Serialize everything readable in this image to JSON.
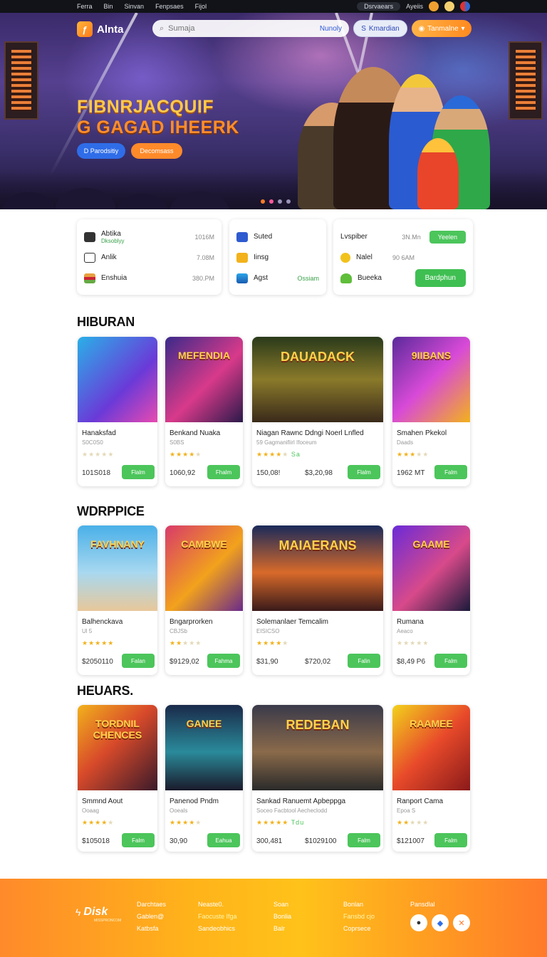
{
  "topbar": {
    "links": [
      "Ferra",
      "Bin",
      "Sinvan",
      "Fenpsaes",
      "Fijol"
    ],
    "pill1": "Dsrvaears",
    "pill2": "Ayeiis"
  },
  "header": {
    "brand": "Alnta",
    "search_placeholder": "Sumaja",
    "search_hint": "Nunoly",
    "login_label": "Kmardian",
    "promo_label": "Tanmalne"
  },
  "hero": {
    "title_line1": "FIBNRJACQUIF",
    "title_line2": "G GAGAD IHEERK",
    "btn_primary": "D  Parodsitiy",
    "btn_secondary": "Decomsass"
  },
  "info_cards": [
    {
      "rows": [
        {
          "label": "Abtika",
          "sub": "Dksoblyy",
          "value": "1016M"
        },
        {
          "label": "Anlik",
          "value": "7.08M"
        },
        {
          "label": "Enshuia",
          "value": "380.PM"
        }
      ]
    },
    {
      "rows": [
        {
          "label": "Suted"
        },
        {
          "label": "Iinsg"
        },
        {
          "label": "Agst",
          "value": "Ossiam"
        }
      ]
    },
    {
      "rows": [
        {
          "label": "Lvspiber",
          "value": "3N.Mn",
          "btn": "Yeelen"
        },
        {
          "label": "Nalel",
          "value": "90 6AM"
        },
        {
          "label": "Bueeka",
          "btn": "Bardphun"
        }
      ]
    }
  ],
  "sections": [
    {
      "title": "HIBURAN",
      "cards": [
        {
          "name": "Hanaksfad",
          "sub": "S0C0S0",
          "rating": 0,
          "price": "101S018",
          "buy": "Flalm",
          "art_text": ""
        },
        {
          "name": "Benkand Nuaka",
          "sub": "S0BS",
          "rating": 4,
          "price": "1060,92",
          "buy": "Fhalm",
          "art_text": "MEFENDIA"
        },
        {
          "name": "Niagan Rawnc Ddngi Noerl Lnfled",
          "sub": "59 Gagmanifiirl Ifoceum",
          "rating": 4,
          "rating_text": "Sa",
          "price": "150,08!",
          "price2": "$3,20,98",
          "buy": "Flalm",
          "art_text": "DAUADACK"
        },
        {
          "name": "Smahen Pkekol",
          "sub": "Daads",
          "rating": 3,
          "price": "1962 MT",
          "buy": "Falm",
          "art_text": "9IIBANS"
        }
      ]
    },
    {
      "title": "WDRPPICE",
      "cards": [
        {
          "name": "Balhenckava",
          "sub": "Ul 5",
          "rating": 5,
          "price": "$2050110",
          "buy": "Falan",
          "art_text": "FAVHNANY"
        },
        {
          "name": "Bngarprorken",
          "sub": "CBJSb",
          "rating": 2,
          "price": "$9129,02",
          "buy": "Fahma",
          "art_text": "CAMBWE"
        },
        {
          "name": "Solemanlaer Temcalim",
          "sub": "EISICSO",
          "rating": 4,
          "price": "$31,90",
          "price2": "$720,02",
          "buy": "Falin",
          "art_text": "MAIAERANS"
        },
        {
          "name": "Rumana",
          "sub": "Aeaco",
          "rating": 0,
          "price": "$8,49 P6",
          "buy": "Falm",
          "art_text": "GAAME"
        }
      ]
    },
    {
      "title": "HEUARS.",
      "cards": [
        {
          "name": "Smmnd Aout",
          "sub": "Ooaag",
          "rating": 4,
          "price": "$105018",
          "buy": "Falm",
          "art_text": "TORDNIL CHENCES"
        },
        {
          "name": "Panenod Pndm",
          "sub": "Ooeals",
          "rating": 4,
          "price": "30,90",
          "buy": "Eahua",
          "art_text": "GANEE"
        },
        {
          "name": "Sankad Ranuemt Apbeppga",
          "sub": "Soceo",
          "sub2": "Facbtool Aecheclodd",
          "rating": 5,
          "rating_text": "Tdu",
          "price": "300,481",
          "price2": "$1029100",
          "buy": "Falm",
          "art_text": "REDEBAN"
        },
        {
          "name": "Ranport Cama",
          "sub": "Epoa S",
          "rating": 2,
          "price": "$121007",
          "buy": "Falm",
          "art_text": "RAAMEE"
        }
      ]
    }
  ],
  "footer": {
    "brand": "Disk",
    "brand_sub": "MISSPRONCOM",
    "col1": [
      "Darchtaes",
      "Gablen@",
      "Katbsfa"
    ],
    "col2": [
      "Neaste0.",
      "Faocuste Ifga",
      "Sandeobhics"
    ],
    "col3": [
      "Soan",
      "Bonlia",
      "Balr"
    ],
    "col4": [
      "Bonlan",
      "Fansbd cjo",
      "Coprsece"
    ],
    "col5": [
      "Pansdlal"
    ]
  },
  "colors": {
    "accent": "#ff8a2a",
    "buy": "#4cc55b",
    "star": "#f2b21c",
    "link": "#2f6de8"
  }
}
